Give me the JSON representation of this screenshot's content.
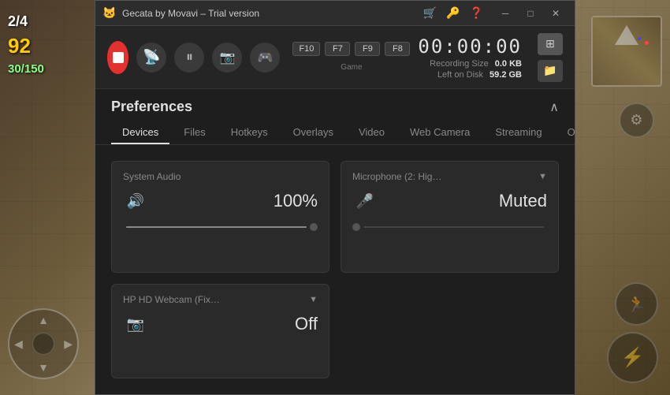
{
  "game_bg": {
    "visible": true
  },
  "hud": {
    "top_left": {
      "line1": "2/4",
      "line2": "92",
      "line3": "30/150"
    }
  },
  "title_bar": {
    "logo": "🐱",
    "title": "Gecata by Movavi – Trial version",
    "icons": [
      "🛒",
      "🔑",
      "❓"
    ],
    "min_btn": "─",
    "max_btn": "□",
    "close_btn": "✕"
  },
  "toolbar": {
    "record_label": "Record",
    "timer": "00:00:00",
    "recording_size_label": "Recording Size",
    "recording_size_value": "0.0 KB",
    "left_on_disk_label": "Left on Disk",
    "left_on_disk_value": "59.2 GB",
    "hotkeys": [
      {
        "key": "F10",
        "label": ""
      },
      {
        "key": "F7",
        "label": ""
      },
      {
        "key": "F9",
        "label": ""
      },
      {
        "key": "F8",
        "label": ""
      },
      {
        "key": "Game",
        "label": ""
      }
    ]
  },
  "preferences": {
    "title": "Preferences",
    "tabs": [
      {
        "id": "devices",
        "label": "Devices",
        "active": true
      },
      {
        "id": "files",
        "label": "Files",
        "active": false
      },
      {
        "id": "hotkeys",
        "label": "Hotkeys",
        "active": false
      },
      {
        "id": "overlays",
        "label": "Overlays",
        "active": false
      },
      {
        "id": "video",
        "label": "Video",
        "active": false
      },
      {
        "id": "webcamera",
        "label": "Web Camera",
        "active": false
      },
      {
        "id": "streaming",
        "label": "Streaming",
        "active": false
      },
      {
        "id": "others",
        "label": "Others",
        "active": false
      }
    ],
    "devices": {
      "system_audio": {
        "name": "System Audio",
        "icon": "🔊",
        "value": "100%",
        "slider_fill": "100"
      },
      "microphone": {
        "name": "Microphone (2: Hig…",
        "dropdown": "▼",
        "icon": "🎤",
        "value": "Muted",
        "muted": true
      },
      "webcam": {
        "name": "HP HD Webcam (Fix…",
        "dropdown": "▼",
        "icon": "📷",
        "value": "Off",
        "muted": true
      }
    }
  }
}
